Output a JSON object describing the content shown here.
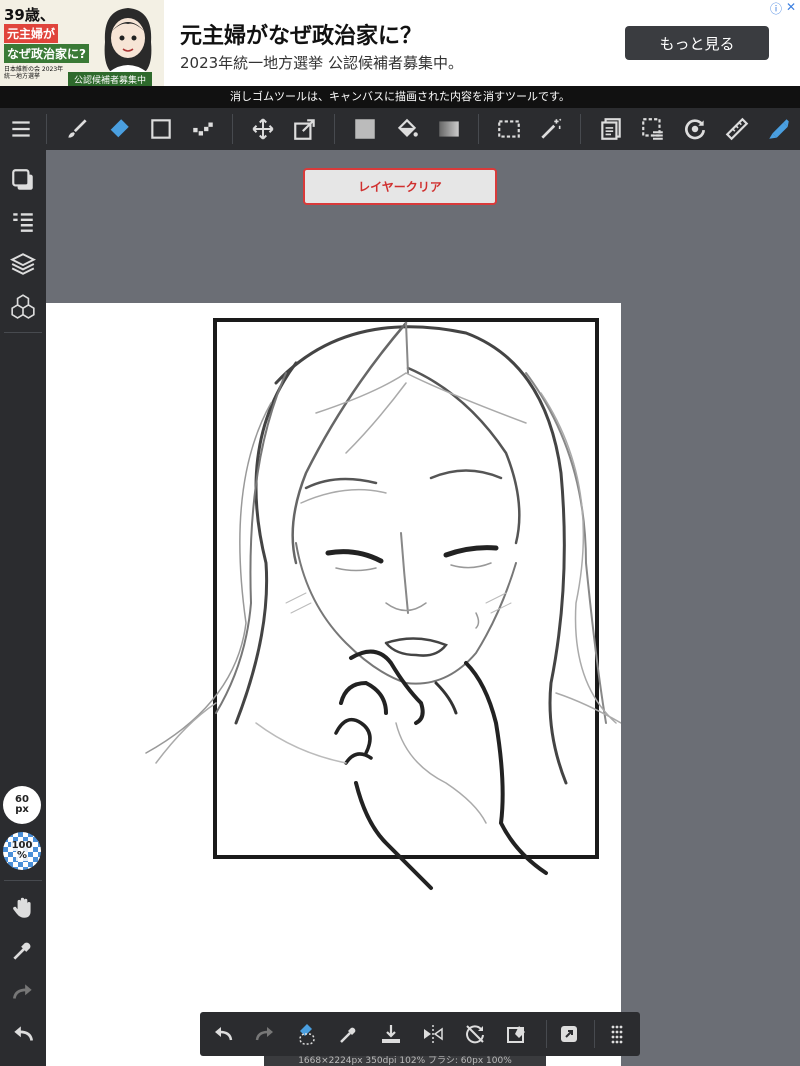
{
  "ad": {
    "age_text": "39歳、",
    "headline_1": "元主婦が",
    "headline_2": "なぜ政治家に?",
    "org_text": "日本維新の会 2023年統一地方選挙",
    "badge_text": "公認候補者募集中",
    "title": "元主婦がなぜ政治家に？",
    "subtitle": "2023年統一地方選挙 公認候補者募集中。",
    "cta_label": "もっと見る",
    "info_icon": "ⓘ",
    "close_icon": "✕"
  },
  "hint": "消しゴムツールは、キャンバスに描画された内容を消すツールです。",
  "toolbar": {
    "items": [
      "menu-icon",
      "brush-icon",
      "eraser-icon",
      "rectangle-icon",
      "dot-icon",
      "move-icon",
      "transform-icon",
      "fill-color-icon",
      "bucket-icon",
      "gradient-icon",
      "select-rect-icon",
      "magic-wand-icon",
      "copy-layer-icon",
      "select-layer-icon",
      "rotate-icon",
      "ruler-icon",
      "pen-icon"
    ],
    "active": "eraser-icon"
  },
  "sidebar": {
    "brush_size_value": "60",
    "brush_size_unit": "px",
    "opacity_value": "100",
    "opacity_unit": "%"
  },
  "clear_layer_label": "レイヤークリア",
  "status_text": "1668×2224px 350dpi 102% ブラシ: 60px 100%",
  "colors": {
    "toolbar_bg": "#2b2c2f",
    "workspace_bg": "#6b6e75",
    "accent_active": "#4a9fe0",
    "clear_border": "#d93a3a"
  }
}
